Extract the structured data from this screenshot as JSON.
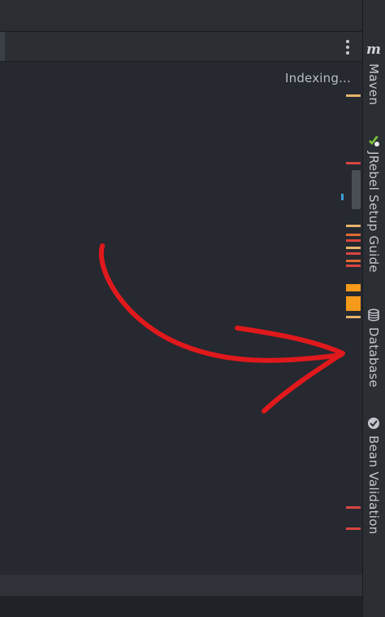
{
  "status": {
    "indexing": "Indexing..."
  },
  "tool_windows": [
    {
      "label": "Maven",
      "icon": "maven-icon",
      "icon_glyph": "m"
    },
    {
      "label": "JRebel Setup Guide",
      "icon": "jrebel-icon"
    },
    {
      "label": "Database",
      "icon": "database-icon"
    },
    {
      "label": "Bean Validation",
      "icon": "bean-validation-icon"
    }
  ],
  "colors": {
    "editor_bg": "#262930",
    "sidebar_bg": "#2b2e33",
    "annotation_red": "#e0191c",
    "marker_warning": "#e5b36a",
    "marker_error": "#d9453f",
    "marker_orange": "#f59a1a",
    "marker_info": "#3e9bd6"
  }
}
